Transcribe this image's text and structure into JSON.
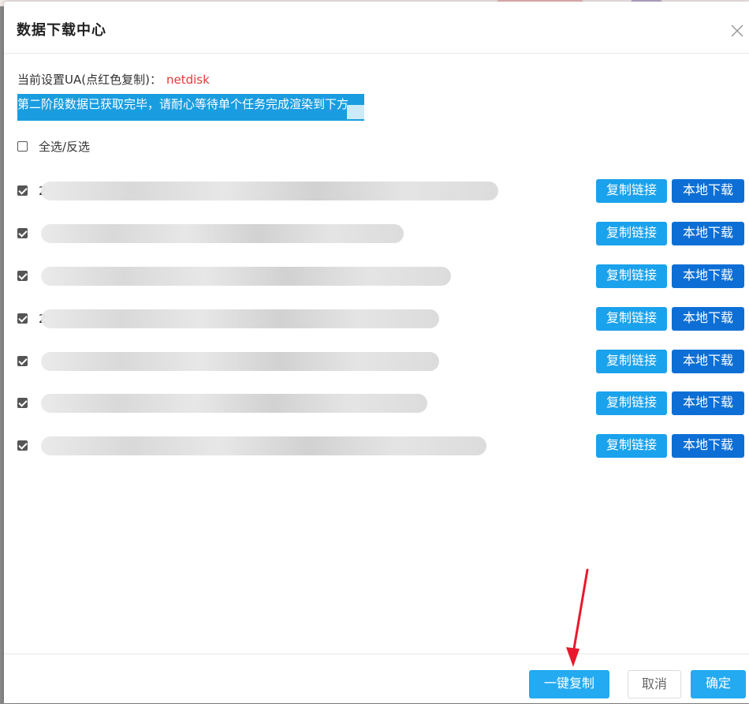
{
  "dialog": {
    "title": "数据下载中心",
    "ua_label": "当前设置UA(点红色复制)：",
    "ua_value": "netdisk",
    "status_text": "第二阶段数据已获取完毕，请耐心等待单个任务完成渲染到下方"
  },
  "select_all": {
    "label": "全选/反选",
    "checked": false
  },
  "tasks": [
    {
      "name_visible": "2",
      "checked": true,
      "copy_label": "复制链接",
      "download_label": "本地下载"
    },
    {
      "name_visible": "",
      "checked": true,
      "copy_label": "复制链接",
      "download_label": "本地下载"
    },
    {
      "name_visible": "",
      "checked": true,
      "copy_label": "复制链接",
      "download_label": "本地下载"
    },
    {
      "name_visible": "2",
      "checked": true,
      "copy_label": "复制链接",
      "download_label": "本地下载"
    },
    {
      "name_visible": "",
      "checked": true,
      "copy_label": "复制链接",
      "download_label": "本地下载"
    },
    {
      "name_visible": "",
      "checked": true,
      "copy_label": "复制链接",
      "download_label": "本地下载"
    },
    {
      "name_visible": "",
      "checked": true,
      "copy_label": "复制链接",
      "download_label": "本地下载"
    }
  ],
  "footer": {
    "copy_all_label": "一键复制",
    "cancel_label": "取消",
    "ok_label": "确定"
  },
  "colors": {
    "ua_value": "#e53935",
    "status_bg": "#1a9de0",
    "copy_button": "#1aa2ec",
    "download_button": "#0d6fd5",
    "primary": "#23aaf0",
    "arrow": "#e8192c"
  }
}
